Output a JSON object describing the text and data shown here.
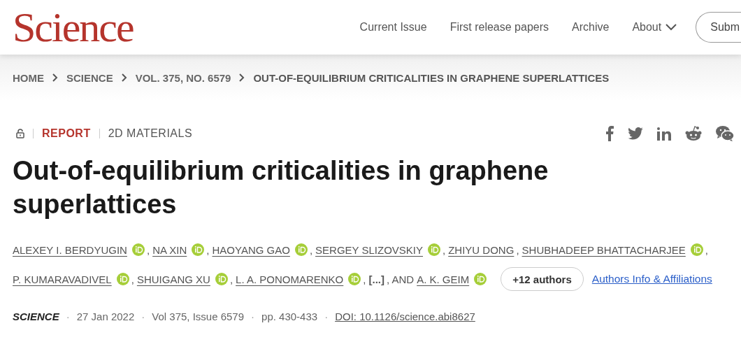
{
  "header": {
    "logo": "Science",
    "nav": [
      {
        "label": "Current Issue",
        "dropdown": false
      },
      {
        "label": "First release papers",
        "dropdown": false
      },
      {
        "label": "Archive",
        "dropdown": false
      },
      {
        "label": "About",
        "dropdown": true
      }
    ],
    "button": "Subm"
  },
  "breadcrumb": [
    "HOME",
    "SCIENCE",
    "VOL. 375, NO. 6579",
    "OUT-OF-EQUILIBRIUM CRITICALITIES IN GRAPHENE SUPERLATTICES"
  ],
  "article": {
    "locked": true,
    "type": "REPORT",
    "category": "2D MATERIALS",
    "share": [
      {
        "kind": "facebook"
      },
      {
        "kind": "twitter"
      },
      {
        "kind": "linkedin"
      },
      {
        "kind": "reddit"
      },
      {
        "kind": "wechat"
      }
    ],
    "title": "Out-of-equilibrium criticalities in graphene superlattices",
    "authors": [
      {
        "kind": "author",
        "name": "ALEXEY I. BERDYUGIN",
        "orcid": true,
        "after": ","
      },
      {
        "kind": "author",
        "name": "NA XIN",
        "orcid": true,
        "after": ","
      },
      {
        "kind": "author",
        "name": "HAOYANG GAO",
        "orcid": true,
        "after": ","
      },
      {
        "kind": "author",
        "name": "SERGEY SLIZOVSKIY",
        "orcid": true,
        "after": ","
      },
      {
        "kind": "author",
        "name": "ZHIYU DONG",
        "orcid": false,
        "after": ","
      },
      {
        "kind": "author",
        "name": "SHUBHADEEP BHATTACHARJEE",
        "orcid": true,
        "after": ","
      },
      {
        "kind": "author",
        "name": "P. KUMARAVADIVEL",
        "orcid": true,
        "after": ","
      },
      {
        "kind": "author",
        "name": "SHUIGANG XU",
        "orcid": true,
        "after": ","
      },
      {
        "kind": "author",
        "name": "L. A. PONOMARENKO",
        "orcid": true,
        "after": ","
      },
      {
        "kind": "more",
        "name": "[...]",
        "after": ", AND"
      },
      {
        "kind": "author",
        "name": "A. K. GEIM",
        "orcid": true
      }
    ],
    "more_authors": "+12 authors",
    "affiliations_link": "Authors Info & Affiliations",
    "meta": [
      {
        "kind": "journal",
        "text": "SCIENCE"
      },
      {
        "kind": "dot",
        "text": "·"
      },
      {
        "kind": "date",
        "text": "27 Jan 2022"
      },
      {
        "kind": "dot",
        "text": "·"
      },
      {
        "kind": "volume",
        "text": "Vol 375, Issue 6579"
      },
      {
        "kind": "dot",
        "text": "·"
      },
      {
        "kind": "pages",
        "text": "pp. 430-433"
      },
      {
        "kind": "dot",
        "text": "·"
      },
      {
        "kind": "doi",
        "text": "DOI: 10.1126/science.abi8627"
      }
    ]
  }
}
